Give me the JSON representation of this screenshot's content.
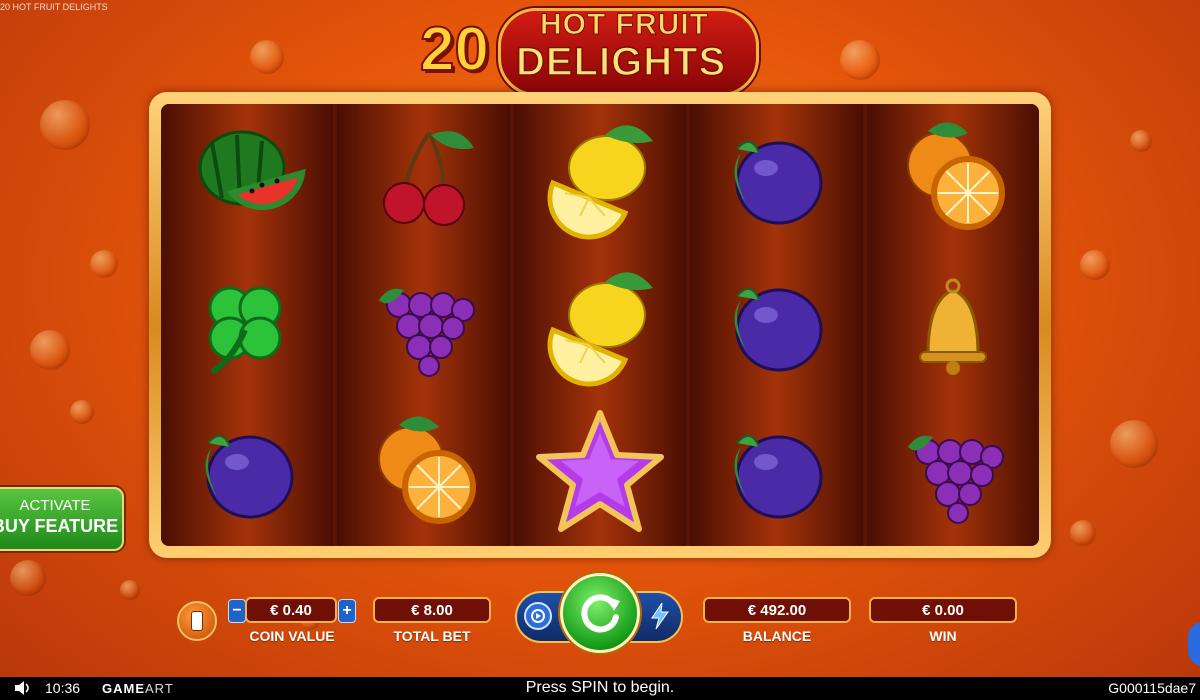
{
  "window": {
    "title": "20 HOT FRUIT DELIGHTS"
  },
  "logo": {
    "number": "20",
    "line1": "HOT FRUIT",
    "line2": "DELIGHTS"
  },
  "reels": [
    [
      "watermelon",
      "clover",
      "plum"
    ],
    [
      "cherries",
      "grapes",
      "orange"
    ],
    [
      "lemon",
      "lemon",
      "star"
    ],
    [
      "plum",
      "plum",
      "plum"
    ],
    [
      "orange",
      "bell",
      "grapes"
    ]
  ],
  "buy_feature": {
    "line1": "ACTIVATE",
    "line2": "BUY FEATURE"
  },
  "controls": {
    "coin_value": "€ 0.40",
    "coin_value_label": "COIN VALUE",
    "total_bet": "€ 8.00",
    "total_bet_label": "TOTAL BET",
    "balance": "€ 492.00",
    "balance_label": "BALANCE",
    "win": "€ 0.00",
    "win_label": "WIN",
    "minus": "−",
    "plus": "+"
  },
  "status_bar": {
    "time": "10:36",
    "brand_game": "GAME",
    "brand_art": "ART",
    "message": "Press SPIN to begin.",
    "game_id": "G000115dae7"
  },
  "colors": {
    "accent_gold": "#f2b344",
    "spin_green": "#169d19",
    "value_bg": "#6f0f06"
  }
}
